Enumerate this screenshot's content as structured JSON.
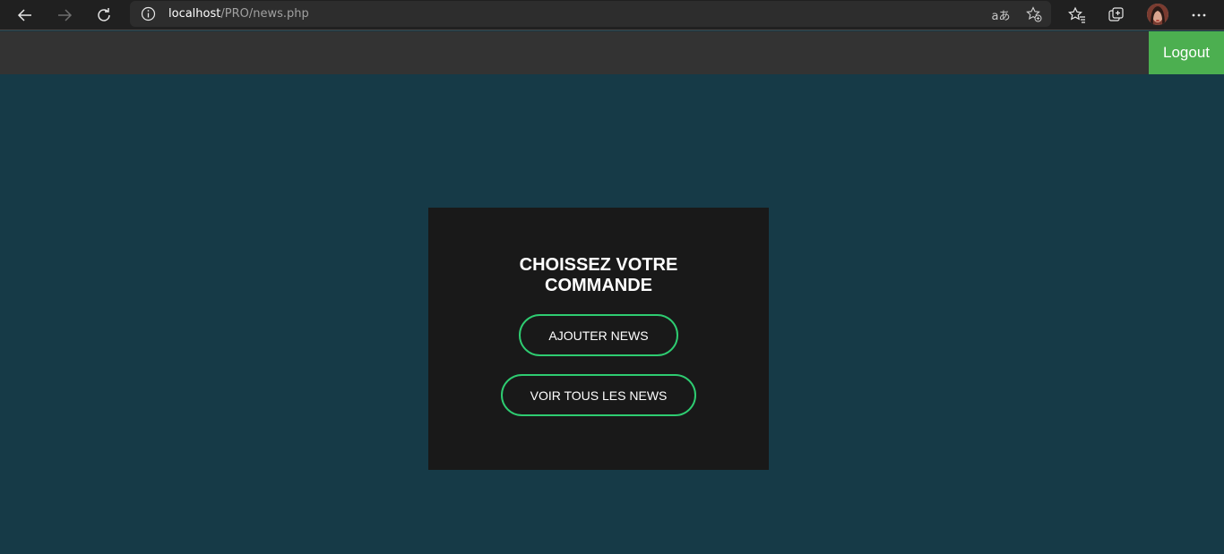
{
  "browser": {
    "url_host": "localhost",
    "url_path": "/PRO/news.php",
    "read_aloud_label": "aあ"
  },
  "header": {
    "logout_label": "Logout"
  },
  "card": {
    "title_line1": "CHOISSEZ VOTRE",
    "title_line2": "COMMANDE",
    "add_news_label": "AJOUTER NEWS",
    "all_news_label": "VOIR TOUS LES NEWS"
  },
  "colors": {
    "page_bg": "#163a47",
    "header_bg": "#333333",
    "logout_bg": "#4caf50",
    "card_bg": "#191919",
    "button_border": "#2ecc71"
  }
}
